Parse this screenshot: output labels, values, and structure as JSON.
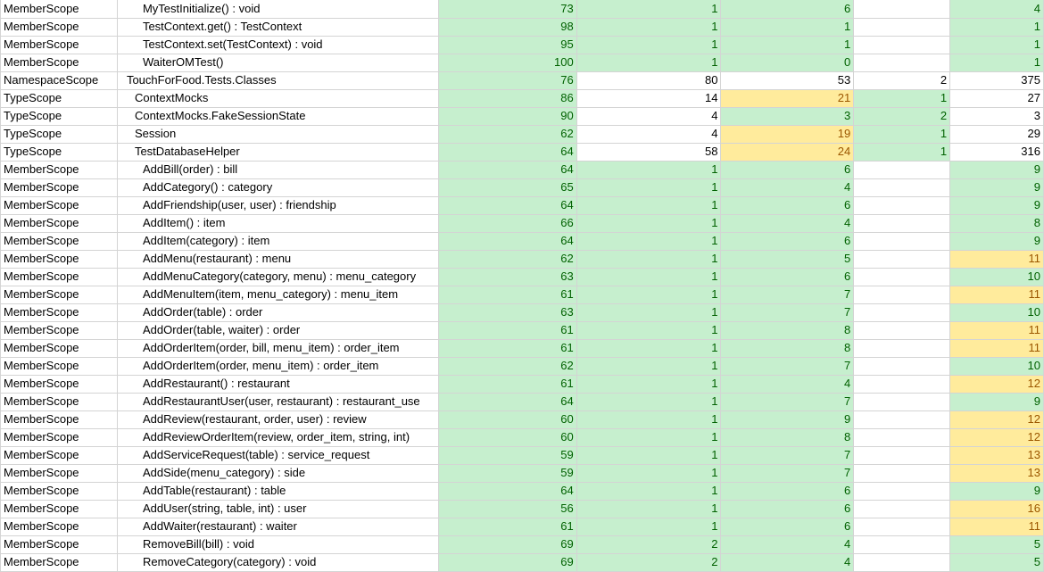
{
  "colors": {
    "green_fill": "#c6efce",
    "green_text": "#006100",
    "yellow_fill": "#ffeb9c",
    "yellow_text": "#9c5700",
    "grid": "#d4d4d4"
  },
  "rows": [
    {
      "kind": "MemberScope",
      "name": "MyTestInitialize() : void",
      "level": 2,
      "v1": "73",
      "v2": "1",
      "v3": "6",
      "v4": "",
      "v5": "4",
      "c": [
        "g",
        "g",
        "g",
        "w",
        "g"
      ]
    },
    {
      "kind": "MemberScope",
      "name": "TestContext.get() : TestContext",
      "level": 2,
      "v1": "98",
      "v2": "1",
      "v3": "1",
      "v4": "",
      "v5": "1",
      "c": [
        "g",
        "g",
        "g",
        "w",
        "g"
      ]
    },
    {
      "kind": "MemberScope",
      "name": "TestContext.set(TestContext) : void",
      "level": 2,
      "v1": "95",
      "v2": "1",
      "v3": "1",
      "v4": "",
      "v5": "1",
      "c": [
        "g",
        "g",
        "g",
        "w",
        "g"
      ]
    },
    {
      "kind": "MemberScope",
      "name": "WaiterOMTest()",
      "level": 2,
      "v1": "100",
      "v2": "1",
      "v3": "0",
      "v4": "",
      "v5": "1",
      "c": [
        "g",
        "g",
        "g",
        "w",
        "g"
      ]
    },
    {
      "kind": "NamespaceScope",
      "name": "TouchForFood.Tests.Classes",
      "level": 0,
      "v1": "76",
      "v2": "80",
      "v3": "53",
      "v4": "2",
      "v5": "375",
      "c": [
        "g",
        "w",
        "w",
        "w",
        "w"
      ]
    },
    {
      "kind": "TypeScope",
      "name": "ContextMocks",
      "level": 1,
      "v1": "86",
      "v2": "14",
      "v3": "21",
      "v4": "1",
      "v5": "27",
      "c": [
        "g",
        "w",
        "y",
        "g",
        "w"
      ]
    },
    {
      "kind": "TypeScope",
      "name": "ContextMocks.FakeSessionState",
      "level": 1,
      "v1": "90",
      "v2": "4",
      "v3": "3",
      "v4": "2",
      "v5": "3",
      "c": [
        "g",
        "w",
        "g",
        "g",
        "w"
      ]
    },
    {
      "kind": "TypeScope",
      "name": "Session",
      "level": 1,
      "v1": "62",
      "v2": "4",
      "v3": "19",
      "v4": "1",
      "v5": "29",
      "c": [
        "g",
        "w",
        "y",
        "g",
        "w"
      ]
    },
    {
      "kind": "TypeScope",
      "name": "TestDatabaseHelper",
      "level": 1,
      "v1": "64",
      "v2": "58",
      "v3": "24",
      "v4": "1",
      "v5": "316",
      "c": [
        "g",
        "w",
        "y",
        "g",
        "w"
      ]
    },
    {
      "kind": "MemberScope",
      "name": "AddBill(order) : bill",
      "level": 2,
      "v1": "64",
      "v2": "1",
      "v3": "6",
      "v4": "",
      "v5": "9",
      "c": [
        "g",
        "g",
        "g",
        "w",
        "g"
      ]
    },
    {
      "kind": "MemberScope",
      "name": "AddCategory() : category",
      "level": 2,
      "v1": "65",
      "v2": "1",
      "v3": "4",
      "v4": "",
      "v5": "9",
      "c": [
        "g",
        "g",
        "g",
        "w",
        "g"
      ]
    },
    {
      "kind": "MemberScope",
      "name": "AddFriendship(user, user) : friendship",
      "level": 2,
      "v1": "64",
      "v2": "1",
      "v3": "6",
      "v4": "",
      "v5": "9",
      "c": [
        "g",
        "g",
        "g",
        "w",
        "g"
      ]
    },
    {
      "kind": "MemberScope",
      "name": "AddItem() : item",
      "level": 2,
      "v1": "66",
      "v2": "1",
      "v3": "4",
      "v4": "",
      "v5": "8",
      "c": [
        "g",
        "g",
        "g",
        "w",
        "g"
      ]
    },
    {
      "kind": "MemberScope",
      "name": "AddItem(category) : item",
      "level": 2,
      "v1": "64",
      "v2": "1",
      "v3": "6",
      "v4": "",
      "v5": "9",
      "c": [
        "g",
        "g",
        "g",
        "w",
        "g"
      ]
    },
    {
      "kind": "MemberScope",
      "name": "AddMenu(restaurant) : menu",
      "level": 2,
      "v1": "62",
      "v2": "1",
      "v3": "5",
      "v4": "",
      "v5": "11",
      "c": [
        "g",
        "g",
        "g",
        "w",
        "y"
      ]
    },
    {
      "kind": "MemberScope",
      "name": "AddMenuCategory(category, menu) : menu_category",
      "level": 2,
      "v1": "63",
      "v2": "1",
      "v3": "6",
      "v4": "",
      "v5": "10",
      "c": [
        "g",
        "g",
        "g",
        "w",
        "g"
      ]
    },
    {
      "kind": "MemberScope",
      "name": "AddMenuItem(item, menu_category) : menu_item",
      "level": 2,
      "v1": "61",
      "v2": "1",
      "v3": "7",
      "v4": "",
      "v5": "11",
      "c": [
        "g",
        "g",
        "g",
        "w",
        "y"
      ]
    },
    {
      "kind": "MemberScope",
      "name": "AddOrder(table) : order",
      "level": 2,
      "v1": "63",
      "v2": "1",
      "v3": "7",
      "v4": "",
      "v5": "10",
      "c": [
        "g",
        "g",
        "g",
        "w",
        "g"
      ]
    },
    {
      "kind": "MemberScope",
      "name": "AddOrder(table, waiter) : order",
      "level": 2,
      "v1": "61",
      "v2": "1",
      "v3": "8",
      "v4": "",
      "v5": "11",
      "c": [
        "g",
        "g",
        "g",
        "w",
        "y"
      ]
    },
    {
      "kind": "MemberScope",
      "name": "AddOrderItem(order, bill, menu_item) : order_item",
      "level": 2,
      "v1": "61",
      "v2": "1",
      "v3": "8",
      "v4": "",
      "v5": "11",
      "c": [
        "g",
        "g",
        "g",
        "w",
        "y"
      ]
    },
    {
      "kind": "MemberScope",
      "name": "AddOrderItem(order, menu_item) : order_item",
      "level": 2,
      "v1": "62",
      "v2": "1",
      "v3": "7",
      "v4": "",
      "v5": "10",
      "c": [
        "g",
        "g",
        "g",
        "w",
        "g"
      ]
    },
    {
      "kind": "MemberScope",
      "name": "AddRestaurant() : restaurant",
      "level": 2,
      "v1": "61",
      "v2": "1",
      "v3": "4",
      "v4": "",
      "v5": "12",
      "c": [
        "g",
        "g",
        "g",
        "w",
        "y"
      ]
    },
    {
      "kind": "MemberScope",
      "name": "AddRestaurantUser(user, restaurant) : restaurant_use",
      "level": 2,
      "v1": "64",
      "v2": "1",
      "v3": "7",
      "v4": "",
      "v5": "9",
      "c": [
        "g",
        "g",
        "g",
        "w",
        "g"
      ]
    },
    {
      "kind": "MemberScope",
      "name": "AddReview(restaurant, order, user) : review",
      "level": 2,
      "v1": "60",
      "v2": "1",
      "v3": "9",
      "v4": "",
      "v5": "12",
      "c": [
        "g",
        "g",
        "g",
        "w",
        "y"
      ]
    },
    {
      "kind": "MemberScope",
      "name": "AddReviewOrderItem(review, order_item, string, int)",
      "level": 2,
      "v1": "60",
      "v2": "1",
      "v3": "8",
      "v4": "",
      "v5": "12",
      "c": [
        "g",
        "g",
        "g",
        "w",
        "y"
      ]
    },
    {
      "kind": "MemberScope",
      "name": "AddServiceRequest(table) : service_request",
      "level": 2,
      "v1": "59",
      "v2": "1",
      "v3": "7",
      "v4": "",
      "v5": "13",
      "c": [
        "g",
        "g",
        "g",
        "w",
        "y"
      ]
    },
    {
      "kind": "MemberScope",
      "name": "AddSide(menu_category) : side",
      "level": 2,
      "v1": "59",
      "v2": "1",
      "v3": "7",
      "v4": "",
      "v5": "13",
      "c": [
        "g",
        "g",
        "g",
        "w",
        "y"
      ]
    },
    {
      "kind": "MemberScope",
      "name": "AddTable(restaurant) : table",
      "level": 2,
      "v1": "64",
      "v2": "1",
      "v3": "6",
      "v4": "",
      "v5": "9",
      "c": [
        "g",
        "g",
        "g",
        "w",
        "g"
      ]
    },
    {
      "kind": "MemberScope",
      "name": "AddUser(string, table, int) : user",
      "level": 2,
      "v1": "56",
      "v2": "1",
      "v3": "6",
      "v4": "",
      "v5": "16",
      "c": [
        "g",
        "g",
        "g",
        "w",
        "y"
      ]
    },
    {
      "kind": "MemberScope",
      "name": "AddWaiter(restaurant) : waiter",
      "level": 2,
      "v1": "61",
      "v2": "1",
      "v3": "6",
      "v4": "",
      "v5": "11",
      "c": [
        "g",
        "g",
        "g",
        "w",
        "y"
      ]
    },
    {
      "kind": "MemberScope",
      "name": "RemoveBill(bill) : void",
      "level": 2,
      "v1": "69",
      "v2": "2",
      "v3": "4",
      "v4": "",
      "v5": "5",
      "c": [
        "g",
        "g",
        "g",
        "w",
        "g"
      ]
    },
    {
      "kind": "MemberScope",
      "name": "RemoveCategory(category) : void",
      "level": 2,
      "v1": "69",
      "v2": "2",
      "v3": "4",
      "v4": "",
      "v5": "5",
      "c": [
        "g",
        "g",
        "g",
        "w",
        "g"
      ]
    }
  ]
}
